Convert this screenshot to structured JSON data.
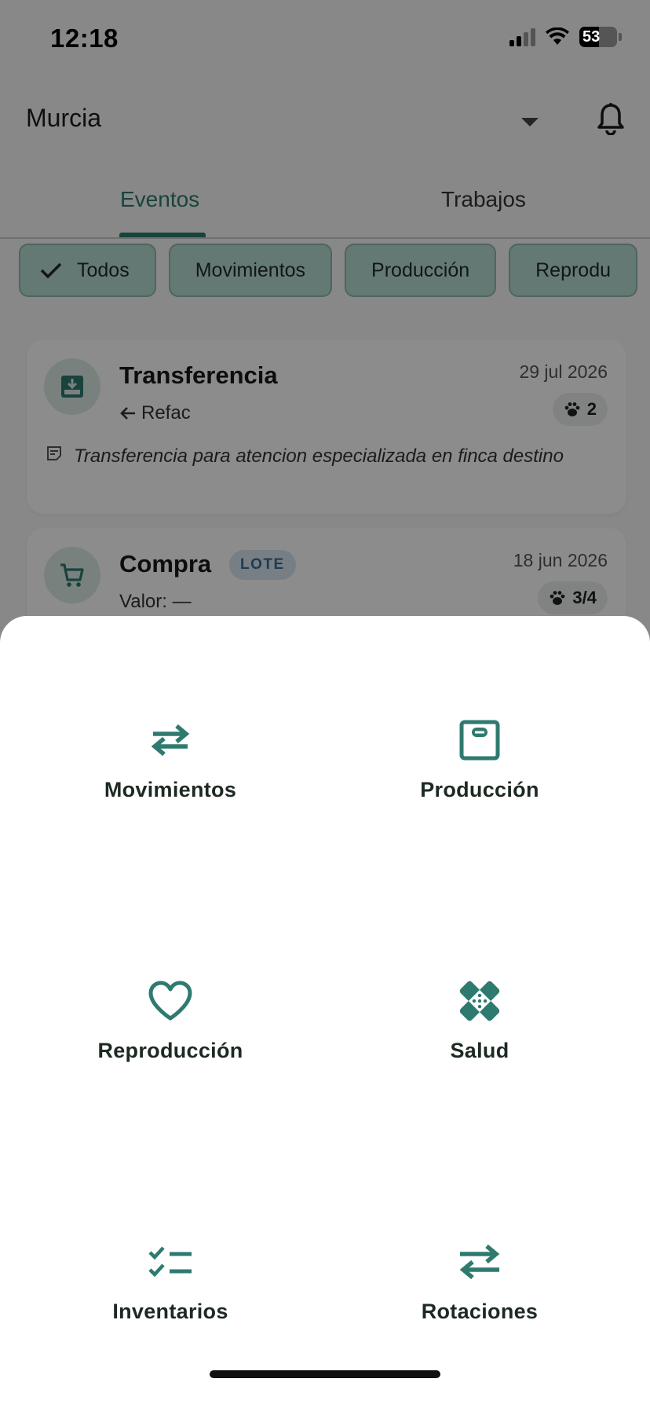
{
  "status_bar": {
    "time": "12:18",
    "battery": "53"
  },
  "header": {
    "location": "Murcia"
  },
  "tabs": [
    {
      "label": "Eventos"
    },
    {
      "label": "Trabajos"
    }
  ],
  "filters": [
    {
      "label": "Todos"
    },
    {
      "label": "Movimientos"
    },
    {
      "label": "Producción"
    },
    {
      "label": "Reprodu"
    }
  ],
  "events": [
    {
      "title": "Transferencia",
      "subtitle": "Refac",
      "date": "29 jul 2026",
      "count": "2",
      "note": "Transferencia para atencion especializada en finca destino"
    },
    {
      "title": "Compra",
      "badge": "LOTE",
      "subtitle": "Valor: —",
      "date": "18 jun 2026",
      "count": "3/4"
    }
  ],
  "sheet": {
    "items": [
      {
        "label": "Movimientos",
        "icon": "swap-horizontal-icon"
      },
      {
        "label": "Producción",
        "icon": "scale-icon"
      },
      {
        "label": "Reproducción",
        "icon": "heart-icon"
      },
      {
        "label": "Salud",
        "icon": "bandage-icon"
      },
      {
        "label": "Inventarios",
        "icon": "checklist-icon"
      },
      {
        "label": "Rotaciones",
        "icon": "rotate-arrows-icon"
      }
    ]
  },
  "colors": {
    "accent": "#2f7a6f",
    "chip_bg": "#b7dcd2",
    "scrim": "rgba(0,0,0,0.45)"
  }
}
